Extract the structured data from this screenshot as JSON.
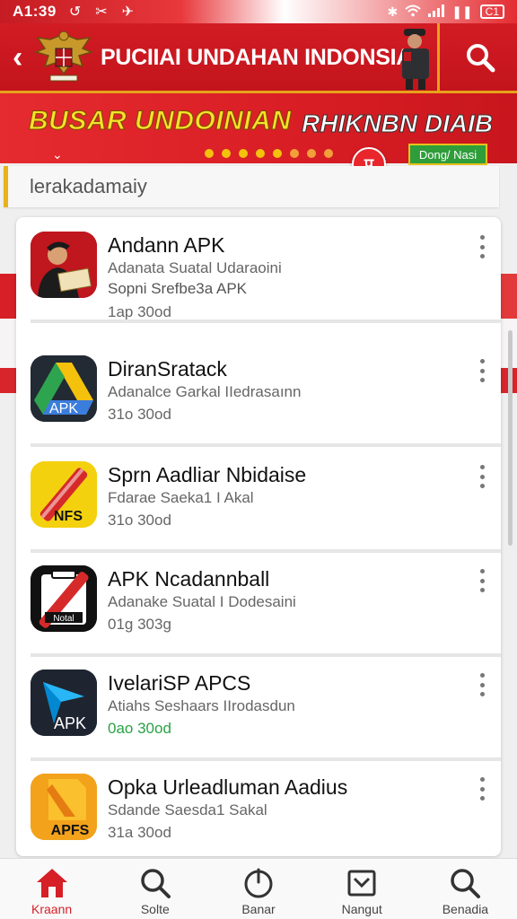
{
  "status_bar": {
    "time": "A1:39",
    "battery": "C1"
  },
  "header": {
    "title": "PUCIIAI UNDAHAN INDONSIA"
  },
  "banner": {
    "headline_yellow": "BUSAR UNDOINIAN",
    "headline_white": "RHIKNBN DIAIB",
    "badge": "प",
    "pill": "Dong/ Nasi"
  },
  "search": {
    "value": "lerakadamaiy"
  },
  "apps": [
    {
      "name": "Andann APK",
      "subtitle": "Adanata Suatal Udaraoini",
      "subtitle2": "Sopni Srefbe3a APK",
      "size": "1ap 30od",
      "size_green": false
    },
    {
      "name": "DiranSratack",
      "subtitle": "Adanalce Garkal IIedrasaınn",
      "subtitle2": "",
      "size": "31o 30od",
      "size_green": false
    },
    {
      "name": "Sprn Aadliar Nbidaise",
      "subtitle": "Fdarae Saeka1 I Akal",
      "subtitle2": "",
      "size": "31o 30od",
      "size_green": false
    },
    {
      "name": "APK Ncadannball",
      "subtitle": "Adanake Suatal I Dodesaini",
      "subtitle2": "",
      "size": "01g 303g",
      "size_green": false
    },
    {
      "name": "IvelariSP APCS",
      "subtitle": "Atiahs Seshaars IIrodasdun",
      "subtitle2": "",
      "size": "0ao 30od",
      "size_green": true
    },
    {
      "name": "Opka Urleadluman Aadius",
      "subtitle": "Sdande Saesda1 Sakal",
      "subtitle2": "",
      "size": "31a 30od",
      "size_green": false
    }
  ],
  "app_icons": [
    {
      "label": "",
      "bg": "#c0161e"
    },
    {
      "label": "APK",
      "bg": "#222a33"
    },
    {
      "label": "NFS",
      "bg": "#f4d10f"
    },
    {
      "label": "Notal",
      "bg": "#111111"
    },
    {
      "label": "APK",
      "bg": "#1e2530"
    },
    {
      "label": "APFS",
      "bg": "#f2a21b"
    }
  ],
  "nav": [
    {
      "label": "Kraann",
      "icon": "home-icon",
      "active": true
    },
    {
      "label": "Solte",
      "icon": "search-icon",
      "active": false
    },
    {
      "label": "Banar",
      "icon": "power-icon",
      "active": false
    },
    {
      "label": "Nangut",
      "icon": "inbox-icon",
      "active": false
    },
    {
      "label": "Benadia",
      "icon": "search-icon",
      "active": false
    }
  ],
  "colors": {
    "primary_red": "#d21c24",
    "accent_gold": "#e8a21a",
    "green": "#2aa245"
  }
}
